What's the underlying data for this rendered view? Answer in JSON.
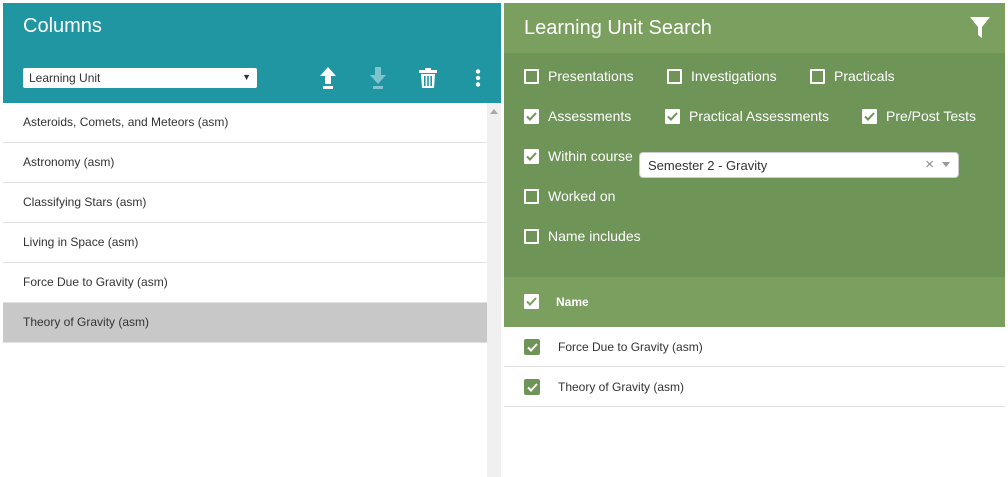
{
  "columns_panel": {
    "title": "Columns",
    "select_value": "Learning Unit",
    "items": [
      {
        "label": "Asteroids, Comets, and Meteors (asm)",
        "selected": false
      },
      {
        "label": "Astronomy (asm)",
        "selected": false
      },
      {
        "label": "Classifying Stars (asm)",
        "selected": false
      },
      {
        "label": "Living in Space (asm)",
        "selected": false
      },
      {
        "label": "Force Due to Gravity (asm)",
        "selected": false
      },
      {
        "label": "Theory of Gravity (asm)",
        "selected": true
      }
    ]
  },
  "search_panel": {
    "title": "Learning Unit Search",
    "filters": {
      "presentations": {
        "label": "Presentations",
        "checked": false
      },
      "investigations": {
        "label": "Investigations",
        "checked": false
      },
      "practicals": {
        "label": "Practicals",
        "checked": false
      },
      "assessments": {
        "label": "Assessments",
        "checked": true
      },
      "practical_assessments": {
        "label": "Practical Assessments",
        "checked": true
      },
      "prepost_tests": {
        "label": "Pre/Post Tests",
        "checked": true
      },
      "within_course": {
        "label": "Within course",
        "checked": true
      },
      "worked_on": {
        "label": "Worked on",
        "checked": false
      },
      "name_includes": {
        "label": "Name includes",
        "checked": false
      }
    },
    "course_value": "Semester 2 - Gravity",
    "results_header": "Name",
    "results": [
      {
        "label": "Force Due to Gravity (asm)",
        "checked": true
      },
      {
        "label": "Theory of Gravity (asm)",
        "checked": true
      }
    ]
  },
  "colors": {
    "teal": "#2196a3",
    "green_header": "#7a9f5e",
    "green_filters": "#6e9457",
    "selected_row": "#c8c8c8"
  },
  "icons": [
    "move-up-icon",
    "move-down-icon",
    "trash-icon",
    "more-vert-icon",
    "filter-icon",
    "checkmark-icon",
    "clear-icon",
    "caret-down-icon"
  ]
}
